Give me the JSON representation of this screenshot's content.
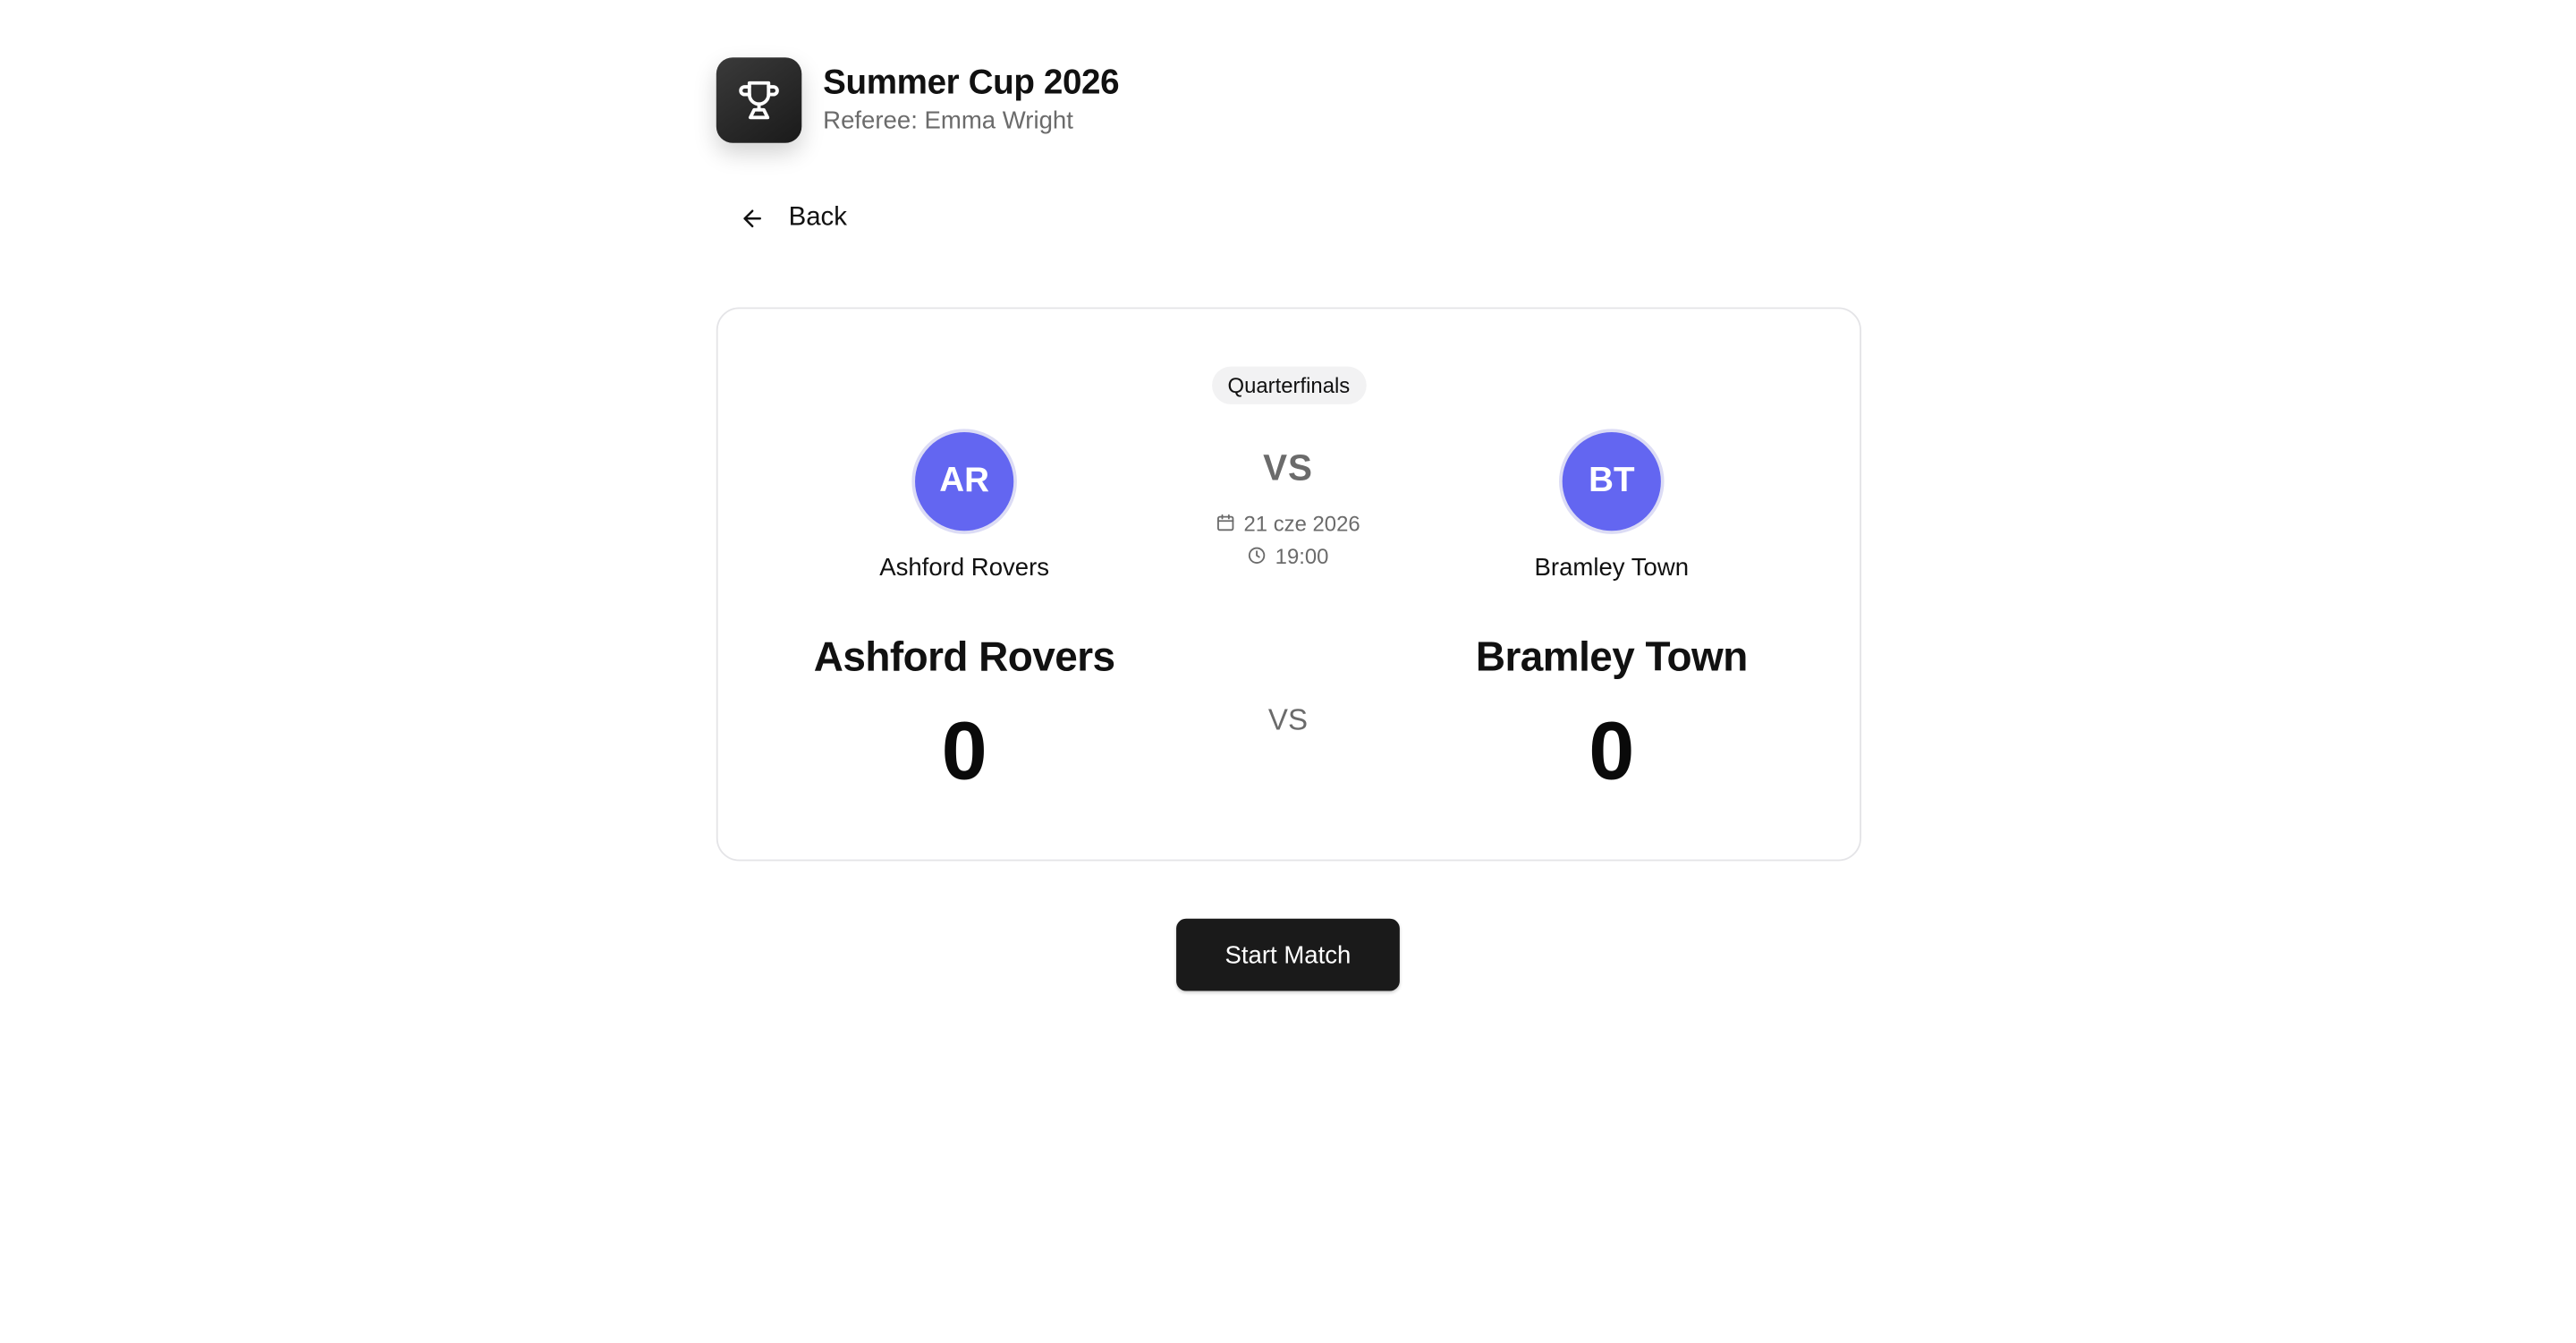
{
  "header": {
    "title": "Summer Cup 2026",
    "subtitle": "Referee: Emma Wright",
    "logo_icon": "trophy-icon"
  },
  "navigation": {
    "back_label": "Back",
    "back_icon": "arrow-left-icon"
  },
  "match": {
    "stage": "Quarterfinals",
    "vs_label": "VS",
    "vs_label_secondary": "VS",
    "date": "21 cze 2026",
    "time": "19:00",
    "date_icon": "calendar-icon",
    "time_icon": "clock-icon",
    "home": {
      "initials": "AR",
      "name": "Ashford Rovers",
      "score": "0",
      "color": "#6366f1"
    },
    "away": {
      "initials": "BT",
      "name": "Bramley Town",
      "score": "0",
      "color": "#6366f1"
    }
  },
  "actions": {
    "start_label": "Start Match"
  }
}
